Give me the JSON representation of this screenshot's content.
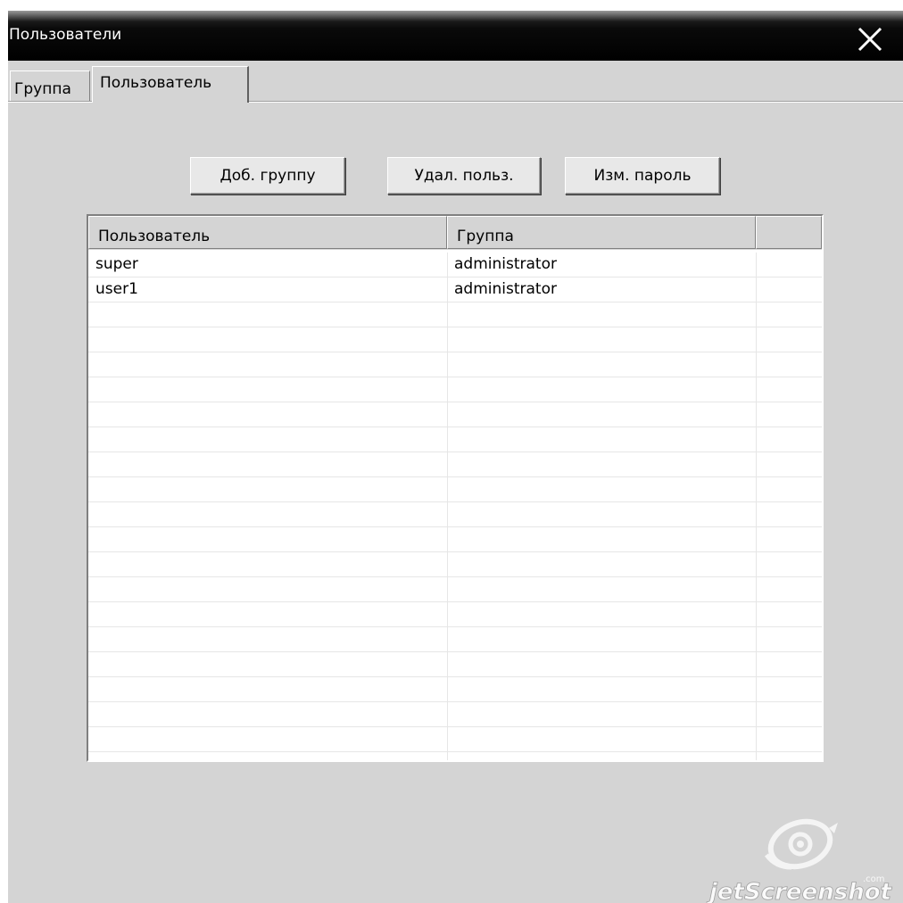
{
  "window": {
    "title": "Пользователи",
    "close_icon": "close-icon"
  },
  "tabs": [
    {
      "label": "Группа",
      "active": false
    },
    {
      "label": "Пользователь",
      "active": true
    }
  ],
  "toolbar": {
    "add_group_label": "Доб. группу",
    "delete_user_label": "Удал. польз.",
    "change_password_label": "Изм. пароль"
  },
  "users_table": {
    "columns": [
      "Пользователь",
      "Группа",
      ""
    ],
    "rows": [
      {
        "user": "super",
        "group": "administrator"
      },
      {
        "user": "user1",
        "group": "administrator"
      }
    ],
    "empty_row_count": 18
  },
  "watermark": {
    "text": "jetScreenshot",
    "suffix": ".com"
  },
  "colors": {
    "titlebar": "#000000",
    "window_bg": "#d4d4d4",
    "list_bg": "#ffffff",
    "grid_line": "#e6e6e6"
  }
}
